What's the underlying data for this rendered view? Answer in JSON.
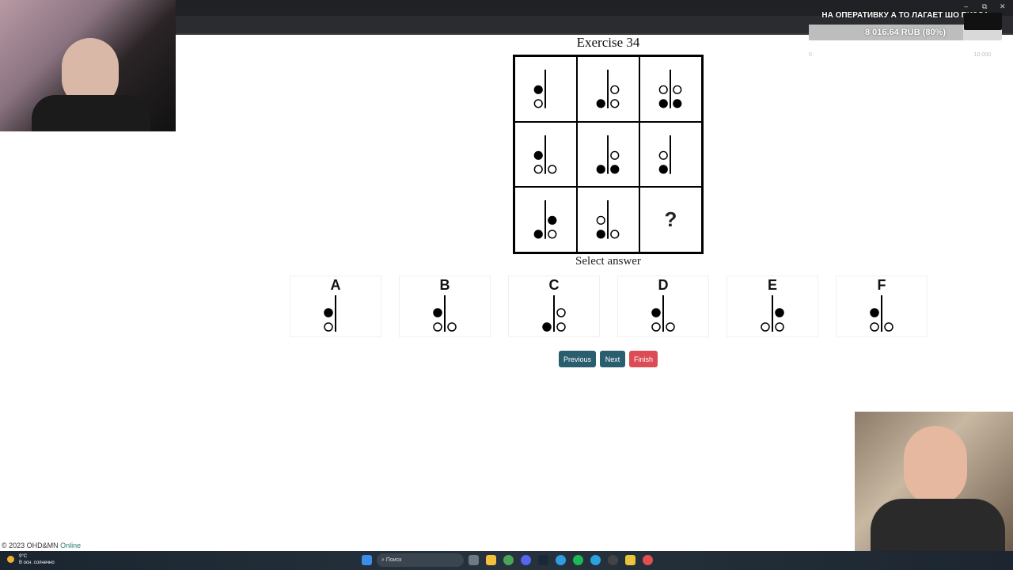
{
  "donation": {
    "title": "НА ОПЕРАТИВКУ А ТО ЛАГАЕТ ШО ПИЗДА",
    "amount": "8 016.64 RUB (80%)",
    "progress_percent": 80,
    "min_label": "0",
    "max_label": "10 000"
  },
  "exercise": {
    "title": "Exercise 34",
    "question_mark": "?",
    "select_label": "Select answer",
    "grid": [
      [
        {
          "left": [
            {
              "f": 1
            },
            {
              "f": 0
            }
          ],
          "right": []
        },
        {
          "left": [
            {
              "f": 1
            }
          ],
          "right": [
            {
              "f": 0
            },
            {
              "f": 0
            }
          ]
        },
        {
          "left": [
            {
              "f": 0
            },
            {
              "f": 1
            }
          ],
          "right": [
            {
              "f": 0
            },
            {
              "f": 1
            }
          ]
        }
      ],
      [
        {
          "left": [
            {
              "f": 1
            },
            {
              "f": 0
            }
          ],
          "right": [
            {
              "f": 0
            }
          ]
        },
        {
          "left": [
            {
              "f": 1
            }
          ],
          "right": [
            {
              "f": 0
            },
            {
              "f": 1
            }
          ]
        },
        {
          "left": [
            {
              "f": 0
            },
            {
              "f": 1
            }
          ],
          "right": []
        }
      ],
      [
        {
          "left": [
            {
              "f": 1
            }
          ],
          "right": [
            {
              "f": 1
            },
            {
              "f": 0
            }
          ]
        },
        {
          "left": [
            {
              "f": 0
            },
            {
              "f": 1
            }
          ],
          "right": [
            {
              "f": 0
            }
          ]
        },
        {
          "question": true
        }
      ]
    ]
  },
  "options": [
    {
      "letter": "A",
      "left": [
        {
          "f": 1
        },
        {
          "f": 0
        }
      ],
      "right": []
    },
    {
      "letter": "B",
      "left": [
        {
          "f": 1
        },
        {
          "f": 0
        }
      ],
      "right": [
        {
          "f": 0
        }
      ]
    },
    {
      "letter": "C",
      "left": [
        {
          "f": 1
        }
      ],
      "right": [
        {
          "f": 0
        },
        {
          "f": 0
        }
      ]
    },
    {
      "letter": "D",
      "left": [
        {
          "f": 1
        },
        {
          "f": 0
        }
      ],
      "right": [
        {
          "f": 0
        }
      ]
    },
    {
      "letter": "E",
      "left": [
        {
          "f": 0
        }
      ],
      "right": [
        {
          "f": 1
        },
        {
          "f": 0
        }
      ]
    },
    {
      "letter": "F",
      "left": [
        {
          "f": 1
        },
        {
          "f": 0
        }
      ],
      "right": [
        {
          "f": 0
        }
      ]
    }
  ],
  "buttons": {
    "previous": "Previous",
    "next": "Next",
    "finish": "Finish"
  },
  "footer": {
    "copyright": "© 2023 OHD&MN",
    "status": "Online"
  },
  "taskbar": {
    "search_placeholder": "Поиск",
    "weather_temp": "9°C",
    "weather_desc": "В осн. солнечно"
  }
}
